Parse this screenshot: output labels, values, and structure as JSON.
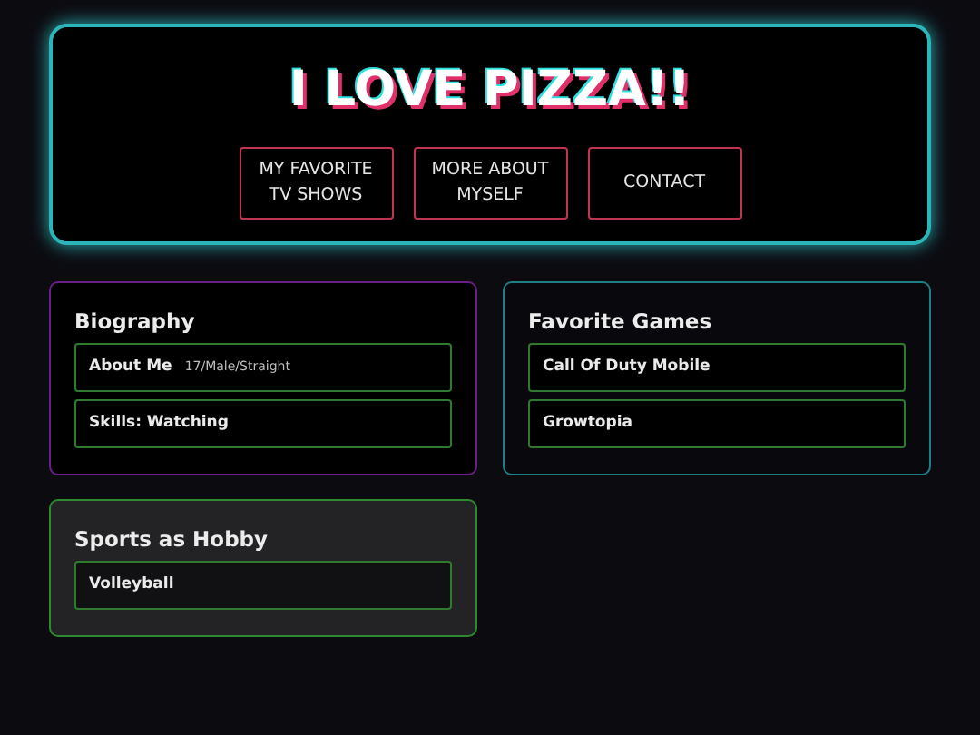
{
  "header": {
    "title": "I LOVE PIZZA!!",
    "nav": [
      {
        "label": "MY FAVORITE TV SHOWS"
      },
      {
        "label": "MORE ABOUT MYSELF"
      },
      {
        "label": "CONTACT"
      }
    ]
  },
  "cards": [
    {
      "title": "Biography",
      "color": "#6a1f86",
      "hovered": false,
      "items": [
        {
          "label": "About Me",
          "detail": "17/Male/Straight"
        },
        {
          "label": "Skills: Watching"
        }
      ]
    },
    {
      "title": "Favorite Games",
      "color": "#1f7f86",
      "hovered": false,
      "items": [
        {
          "label": "Call Of Duty Mobile"
        },
        {
          "label": "Growtopia"
        }
      ]
    },
    {
      "title": "Sports as Hobby",
      "color": "#2f8a2f",
      "hovered": true,
      "items": [
        {
          "label": "Volleyball"
        }
      ]
    }
  ]
}
